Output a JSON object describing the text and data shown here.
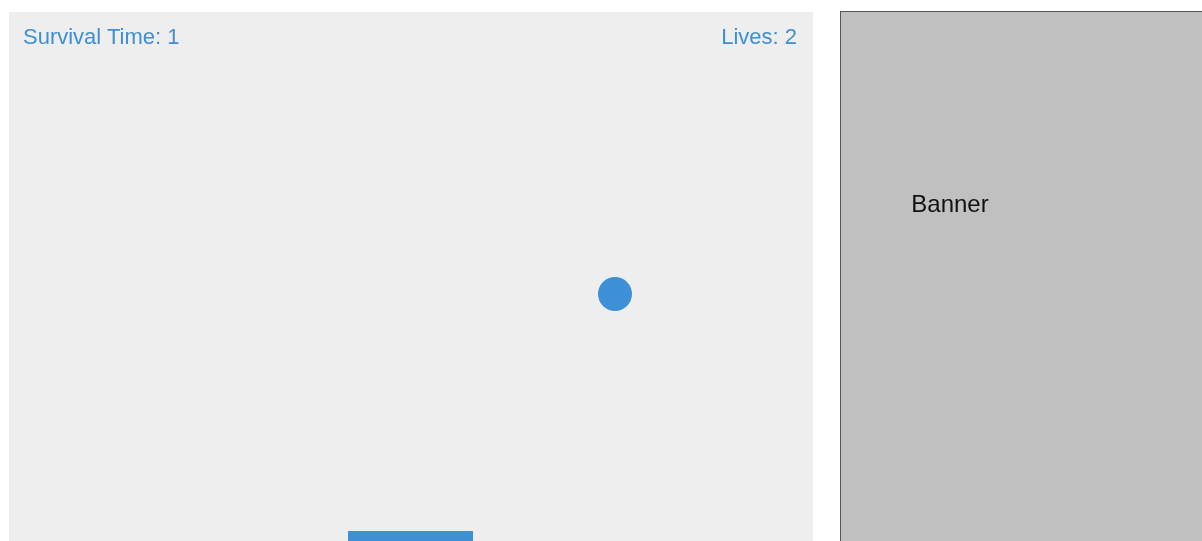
{
  "game": {
    "survival_time": "Survival Time: 1",
    "lives": "Lives: 2"
  },
  "banner": {
    "label": "Banner"
  }
}
